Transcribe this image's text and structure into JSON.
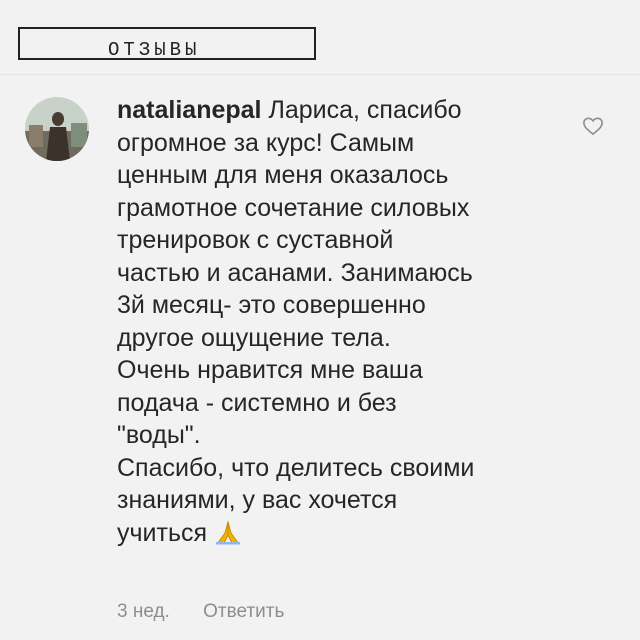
{
  "header": {
    "section_label": "ОТЗЫВЫ"
  },
  "comment": {
    "username": "natalianepal",
    "lines": [
      "Лариса, спасибо",
      "огромное за курс! Самым",
      "ценным для меня оказалось",
      "грамотное сочетание силовых",
      "тренировок с суставной",
      "частью и асанами. Занимаюсь",
      "3й месяц- это совершенно",
      "другое ощущение тела.",
      "Очень нравится мне ваша",
      "подача - системно и без",
      "\"воды\".",
      "Спасибо, что делитесь своими",
      "знаниями, у вас хочется",
      "учиться"
    ],
    "emoji_icon": "folded-hands-icon",
    "like_icon": "heart-outline-icon"
  },
  "meta": {
    "time": "3 нед.",
    "reply_label": "Ответить"
  },
  "colors": {
    "background": "#f2f2f2",
    "text": "#262626",
    "meta_text": "#8e8e8e",
    "emoji": "#f4b400"
  }
}
